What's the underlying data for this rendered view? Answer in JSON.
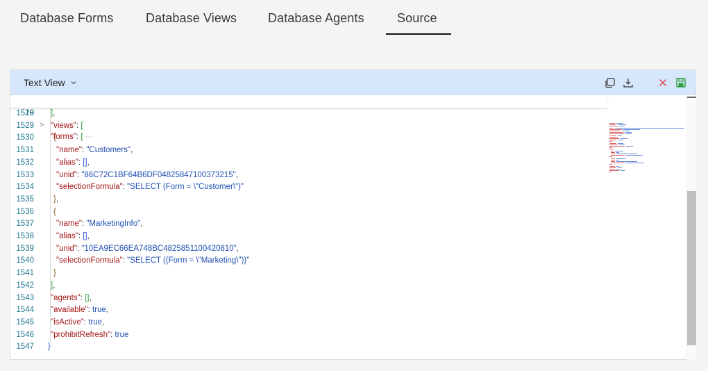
{
  "tabs": [
    {
      "label": "Database Forms",
      "active": false
    },
    {
      "label": "Database Views",
      "active": false
    },
    {
      "label": "Database Agents",
      "active": false
    },
    {
      "label": "Source",
      "active": true
    }
  ],
  "editor": {
    "view_mode": "Text View",
    "icons": [
      "copy-icon",
      "download-icon",
      "discard-icon",
      "save-icon"
    ],
    "colors": {
      "header_bg": "#d6e7fb",
      "key": "#a31515",
      "string": "#1f4fb4",
      "line_number": "#237893",
      "discard": "#e0393e",
      "save": "#2e9e3e"
    },
    "sticky_line": {
      "number": "19",
      "key": "\"forms\"",
      "rest": ": [",
      "collapsed": "···"
    },
    "lines": [
      {
        "n": "1528",
        "text": "],"
      },
      {
        "n": "1529",
        "text": "\"views\": ["
      },
      {
        "n": "1530",
        "text": "{"
      },
      {
        "n": "1531",
        "text": "\"name\": \"Customers\","
      },
      {
        "n": "1532",
        "text": "\"alias\": [],"
      },
      {
        "n": "1533",
        "text": "\"unid\": \"86C72C1BF64B6DF04825847100373215\","
      },
      {
        "n": "1534",
        "text": "\"selectionFormula\": \"SELECT (Form = \\\"Customer\\\")\""
      },
      {
        "n": "1535",
        "text": "},"
      },
      {
        "n": "1536",
        "text": "{"
      },
      {
        "n": "1537",
        "text": "\"name\": \"MarketingInfo\","
      },
      {
        "n": "1538",
        "text": "\"alias\": [],"
      },
      {
        "n": "1539",
        "text": "\"unid\": \"10EA9EC66EA748BC4825851100420810\","
      },
      {
        "n": "1540",
        "text": "\"selectionFormula\": \"SELECT ((Form = \\\"Marketing\\\"))\""
      },
      {
        "n": "1541",
        "text": "}"
      },
      {
        "n": "1542",
        "text": "],"
      },
      {
        "n": "1543",
        "text": "\"agents\": [],"
      },
      {
        "n": "1544",
        "text": "\"available\": true,"
      },
      {
        "n": "1545",
        "text": "\"isActive\": true,"
      },
      {
        "n": "1546",
        "text": "\"prohibitRefresh\": true"
      },
      {
        "n": "1547",
        "text": "}"
      }
    ],
    "tokens": {
      "l1528": [
        "]",
        ","
      ],
      "l1529": [
        "\"views\"",
        ": ",
        "["
      ],
      "l1530": [
        "{"
      ],
      "l1531": [
        "\"name\"",
        ": ",
        "\"Customers\"",
        ","
      ],
      "l1532": [
        "\"alias\"",
        ": ",
        "[]",
        ","
      ],
      "l1533": [
        "\"unid\"",
        ": ",
        "\"86C72C1BF64B6DF04825847100373215\"",
        ","
      ],
      "l1534": [
        "\"selectionFormula\"",
        ": ",
        "\"SELECT (Form = \\\"Customer\\\")\""
      ],
      "l1535": [
        "}",
        ","
      ],
      "l1536": [
        "{"
      ],
      "l1537": [
        "\"name\"",
        ": ",
        "\"MarketingInfo\"",
        ","
      ],
      "l1538": [
        "\"alias\"",
        ": ",
        "[]",
        ","
      ],
      "l1539": [
        "\"unid\"",
        ": ",
        "\"10EA9EC66EA748BC4825851100420810\"",
        ","
      ],
      "l1540": [
        "\"selectionFormula\"",
        ": ",
        "\"SELECT ((Form = \\\"Marketing\\\"))\""
      ],
      "l1541": [
        "}"
      ],
      "l1542": [
        "]",
        ","
      ],
      "l1543": [
        "\"agents\"",
        ": ",
        "[]",
        ","
      ],
      "l1544": [
        "\"available\"",
        ": ",
        "true",
        ","
      ],
      "l1545": [
        "\"isActive\"",
        ": ",
        "true",
        ","
      ],
      "l1546": [
        "\"prohibitRefresh\"",
        ": ",
        "true"
      ],
      "l1547": [
        "}"
      ]
    },
    "scroll_position_fraction": 0.55
  }
}
